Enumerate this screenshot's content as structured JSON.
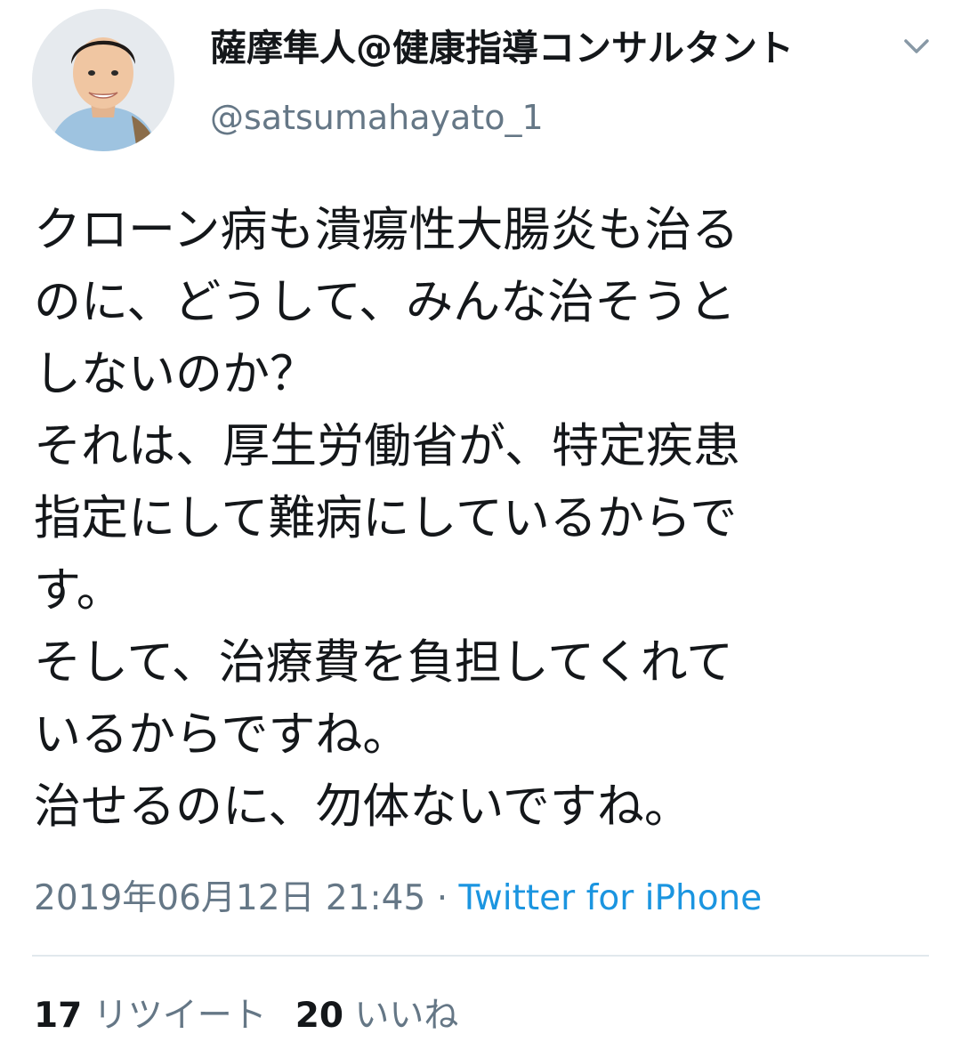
{
  "user": {
    "display_name": "薩摩隼人@健康指導コンサルタント",
    "handle": "@satsumahayato_1",
    "avatar_icon": "profile-photo"
  },
  "tweet": {
    "text": "クローン病も潰瘍性大腸炎も治る\nのに、どうして、みんな治そうと\nしないのか？\nそれは、厚生労働省が、特定疾患\n指定にして難病にしているからで\nす。\nそして、治療費を負担してくれて\nいるからですね。\n治せるのに、勿体ないですね。",
    "timestamp": "2019年06月12日 21:45",
    "separator": " · ",
    "source": "Twitter for iPhone"
  },
  "stats": {
    "retweets_count": "17",
    "retweets_label": "リツイート",
    "likes_count": "20",
    "likes_label": "いいね"
  },
  "colors": {
    "text": "#14171a",
    "secondary": "#657786",
    "link": "#1b95e0",
    "divider": "#e1e8ed"
  }
}
